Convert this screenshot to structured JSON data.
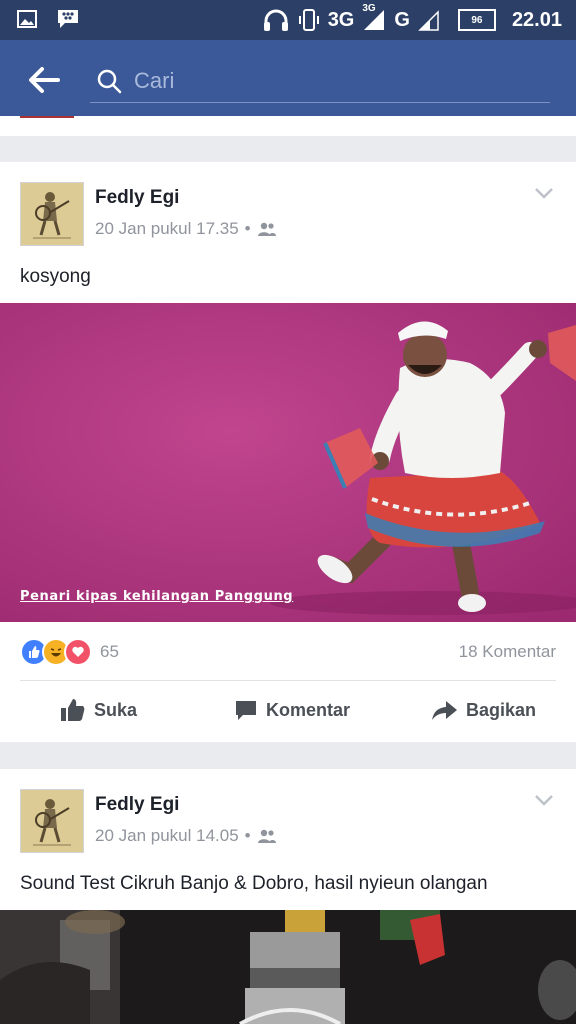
{
  "status_bar": {
    "network_3g": "3G",
    "network_3g_small": "3G",
    "network_g": "G",
    "battery": "96",
    "time": "22.01"
  },
  "search": {
    "placeholder": "Cari"
  },
  "posts": [
    {
      "author": "Fedly Egi",
      "timestamp": "20 Jan pukul 17.35",
      "separator": "•",
      "text": "kosyong",
      "image_caption": "Penari kipas kehilangan Panggung",
      "reaction_count": "65",
      "comment_count": "18 Komentar",
      "actions": {
        "like": "Suka",
        "comment": "Komentar",
        "share": "Bagikan"
      }
    },
    {
      "author": "Fedly Egi",
      "timestamp": "20 Jan pukul 14.05",
      "separator": "•",
      "text": "Sound Test Cikruh Banjo & Dobro, hasil nyieun olangan"
    }
  ],
  "colors": {
    "brand": "#3b5998",
    "status_bar": "#2c3f66",
    "like": "#4080ff",
    "haha": "#f7b125",
    "love": "#f25268"
  },
  "icons": [
    "image-icon",
    "bbm-icon",
    "headphones-icon",
    "vibrate-icon",
    "signal-icon",
    "battery-icon",
    "back-arrow-icon",
    "search-icon",
    "friends-icon",
    "chevron-down-icon",
    "like-icon",
    "comment-icon",
    "share-icon"
  ]
}
